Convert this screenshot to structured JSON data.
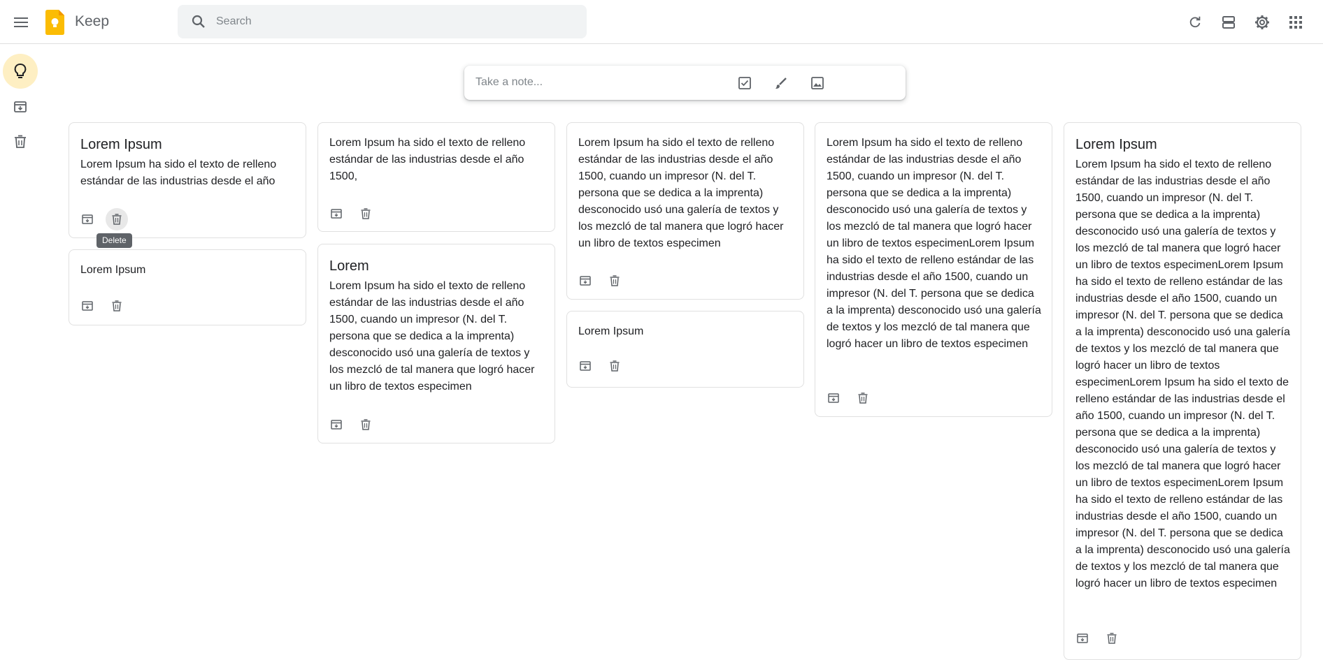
{
  "app": {
    "title": "Keep"
  },
  "search": {
    "placeholder": "Search"
  },
  "take_note": {
    "placeholder": "Take a note..."
  },
  "tooltip": {
    "text": "Delete"
  },
  "notes": [
    {
      "title": "Lorem Ipsum",
      "body": "Lorem Ipsum ha sido el texto de relleno estándar de las industrias desde el año"
    },
    {
      "title": "",
      "body": "Lorem Ipsum"
    },
    {
      "title": "",
      "body": "Lorem Ipsum ha sido el texto de relleno estándar de las industrias desde el año 1500,"
    },
    {
      "title": "Lorem",
      "body": "Lorem Ipsum ha sido el texto de relleno estándar de las industrias desde el año 1500, cuando un impresor (N. del T. persona que se dedica a la imprenta) desconocido usó una galería de textos y los mezcló de tal manera que logró hacer un libro de textos especimen"
    },
    {
      "title": "",
      "body": "Lorem Ipsum ha sido el texto de relleno estándar de las industrias desde el año 1500, cuando un impresor (N. del T. persona que se dedica a la imprenta) desconocido usó una galería de textos y los mezcló de tal manera que logró hacer un libro de textos especimen"
    },
    {
      "title": "",
      "body": "Lorem Ipsum"
    },
    {
      "title": "",
      "body": "Lorem Ipsum ha sido el texto de relleno estándar de las industrias desde el año 1500, cuando un impresor (N. del T. persona que se dedica a la imprenta) desconocido usó una galería de textos y los mezcló de tal manera que logró hacer un libro de textos especimenLorem Ipsum ha sido el texto de relleno estándar de las industrias desde el año 1500, cuando un impresor (N. del T. persona que se dedica a la imprenta) desconocido usó una galería de textos y los mezcló de tal manera que logró hacer un libro de textos especimen"
    },
    {
      "title": "Lorem Ipsum",
      "body": "Lorem Ipsum ha sido el texto de relleno estándar de las industrias desde el año 1500, cuando un impresor (N. del T. persona que se dedica a la imprenta) desconocido usó una galería de textos y los mezcló de tal manera que logró hacer un libro de textos especimenLorem Ipsum ha sido el texto de relleno estándar de las industrias desde el año 1500, cuando un impresor (N. del T. persona que se dedica a la imprenta) desconocido usó una galería de textos y los mezcló de tal manera que logró hacer un libro de textos especimenLorem Ipsum ha sido el texto de relleno estándar de las industrias desde el año 1500, cuando un impresor (N. del T. persona que se dedica a la imprenta) desconocido usó una galería de textos y los mezcló de tal manera que logró hacer un libro de textos especimenLorem Ipsum ha sido el texto de relleno estándar de las industrias desde el año 1500, cuando un impresor (N. del T. persona que se dedica a la imprenta) desconocido usó una galería de textos y los mezcló de tal manera que logró hacer un libro de textos especimen"
    }
  ],
  "colors": {
    "accent": "#feefc3",
    "logo": "#fbbc04",
    "icon": "#5f6368",
    "border": "#e0e0e0",
    "search_bg": "#f1f3f4"
  },
  "icons": {
    "header": [
      "menu-icon",
      "keep-logo-icon",
      "search-icon",
      "refresh-icon",
      "list-view-icon",
      "settings-icon",
      "apps-grid-icon"
    ],
    "sidebar": [
      "lightbulb-icon",
      "archive-icon",
      "trash-icon"
    ],
    "take_note": [
      "checkbox-icon",
      "brush-icon",
      "image-icon"
    ],
    "note_actions": [
      "archive-icon",
      "delete-icon"
    ]
  }
}
